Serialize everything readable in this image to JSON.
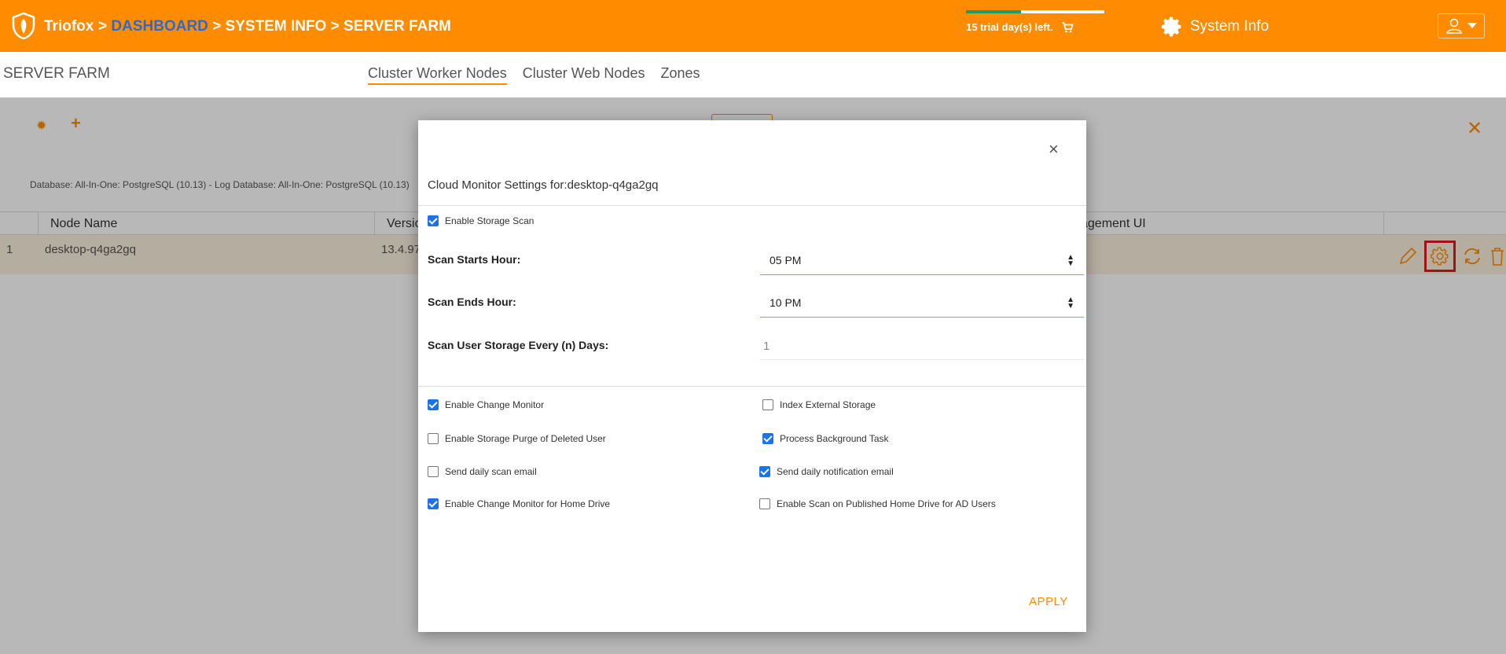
{
  "header": {
    "brand": "Triofox",
    "crumb_sep1": ">",
    "crumb_dashboard": "DASHBOARD",
    "crumb_rest": "> SYSTEM INFO > SERVER FARM",
    "trial_text": "15 trial day(s) left.",
    "trial_progress": 0.4,
    "system_info": "System Info"
  },
  "subheader": {
    "title": "SERVER FARM",
    "tabs": [
      "Cluster Worker Nodes",
      "Cluster Web Nodes",
      "Zones"
    ]
  },
  "content": {
    "db_info": "Database: All-In-One: PostgreSQL (10.13) - Log Database: All-In-One: PostgreSQL (10.13)",
    "columns": {
      "node_name": "Node Name",
      "version": "Versio",
      "mgmt": "agement UI"
    },
    "row": {
      "index": "1",
      "node": "desktop-q4ga2gq",
      "version": "13.4.97"
    }
  },
  "modal": {
    "title": "Cloud Monitor Settings for:desktop-q4ga2gq",
    "enable_storage_scan": "Enable Storage Scan",
    "scan_starts_label": "Scan Starts Hour:",
    "scan_starts_value": "05 PM",
    "scan_ends_label": "Scan Ends Hour:",
    "scan_ends_value": "10 PM",
    "scan_days_label": "Scan User Storage Every (n) Days:",
    "scan_days_value": "1",
    "options": {
      "change_monitor": "Enable Change Monitor",
      "index_external": "Index External Storage",
      "purge_deleted": "Enable Storage Purge of Deleted User",
      "background_task": "Process Background Task",
      "daily_scan_email": "Send daily scan email",
      "daily_notification_email": "Send daily notification email",
      "home_drive_monitor": "Enable Change Monitor for Home Drive",
      "published_home_drive": "Enable Scan on Published Home Drive for AD Users"
    },
    "apply": "APPLY",
    "close": "×"
  },
  "colors": {
    "brand": "#ff8c00",
    "link": "#2a6bd1",
    "checkbox": "#1a73e8",
    "highlight": "#e01b1b"
  }
}
